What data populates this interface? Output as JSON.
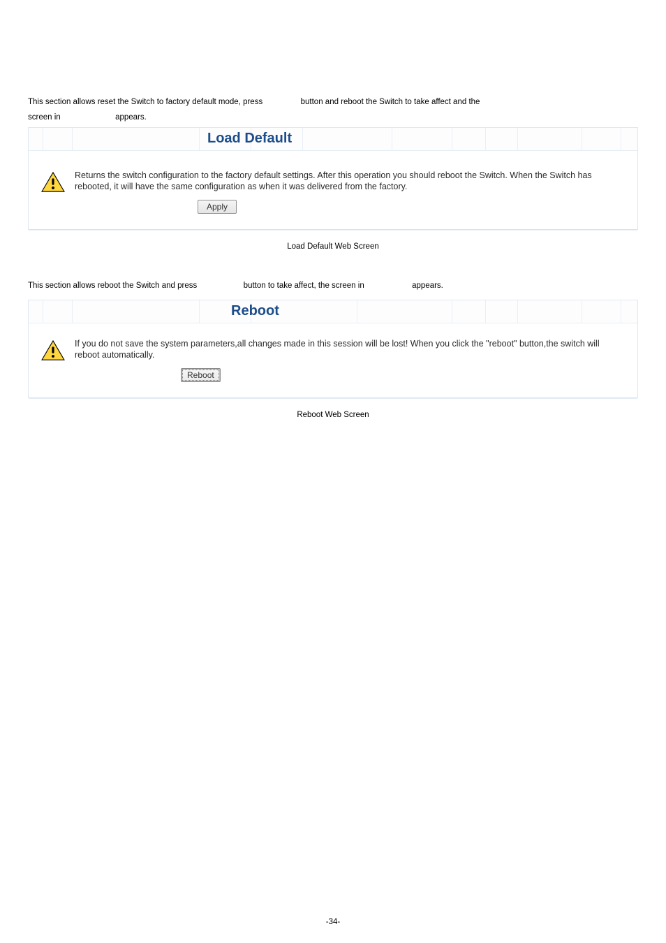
{
  "intro1": {
    "p1": "This section allows reset the Switch to factory default mode, press",
    "p2": "button and reboot the Switch to take affect and the",
    "p3": "screen in",
    "p4": "appears."
  },
  "panel1": {
    "title": "Load Default",
    "message": "Returns the switch configuration to the factory default settings. After this operation you should reboot the Switch. When the Switch has rebooted, it will have the same configuration as when it was delivered from the factory.",
    "button": "Apply"
  },
  "caption1": "Load Default Web Screen",
  "intro2": {
    "p1": "This section allows reboot the Switch and press",
    "p2": "button to take affect, the screen in",
    "p3": "appears."
  },
  "panel2": {
    "title": "Reboot",
    "message": "If you do not save the system parameters,all changes made in this session will be lost! When you click the \"reboot\" button,the switch will reboot automatically.",
    "button": "Reboot"
  },
  "caption2": "Reboot Web Screen",
  "pageNumber": "-34-"
}
